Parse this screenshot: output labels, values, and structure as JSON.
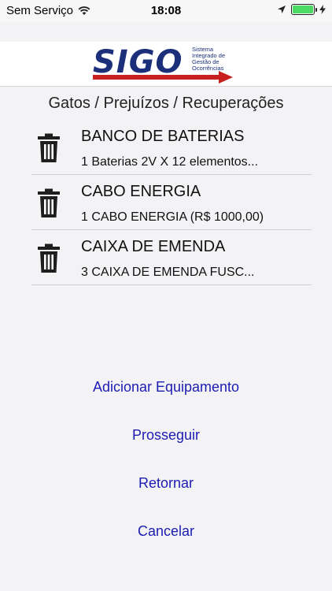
{
  "status_bar": {
    "carrier": "Sem Serviço",
    "time": "18:08",
    "battery_level": 1.0
  },
  "logo": {
    "word": "SIGO",
    "subtitle": "Sistema Integrado de Gestão de Ocorrências"
  },
  "section_title": "Gatos / Prejuízos / Recuperações",
  "items": [
    {
      "title": "BANCO DE BATERIAS",
      "detail": "1  Baterias 2V X 12 elementos..."
    },
    {
      "title": "CABO ENERGIA",
      "detail": "1 CABO ENERGIA (R$ 1000,00)"
    },
    {
      "title": "CAIXA DE EMENDA",
      "detail": "3 CAIXA DE EMENDA FUSC..."
    }
  ],
  "actions": {
    "add": "Adicionar Equipamento",
    "proceed": "Prosseguir",
    "back": "Retornar",
    "cancel": "Cancelar"
  },
  "colors": {
    "link": "#1c1cb3",
    "brand_blue": "#1c2f7a",
    "brand_red": "#c8201f",
    "battery": "#4cd964"
  }
}
